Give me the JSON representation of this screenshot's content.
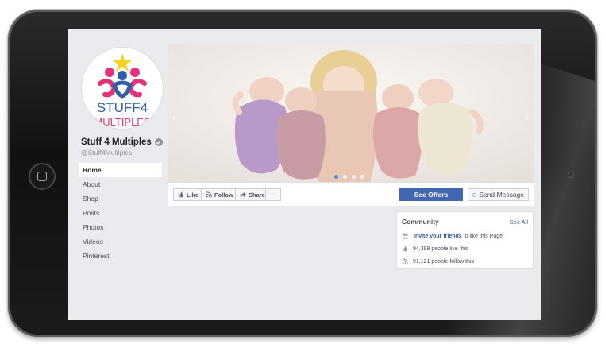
{
  "page": {
    "name": "Stuff 4 Multiples",
    "handle": "@Stuff4Multiples"
  },
  "nav": {
    "items": [
      "Home",
      "About",
      "Shop",
      "Posts",
      "Photos",
      "Videos",
      "Pinterest"
    ]
  },
  "actions": {
    "like": "Like",
    "follow": "Follow",
    "share": "Share",
    "more": "···",
    "see_offers": "See Offers",
    "send_message": "Send Message"
  },
  "community": {
    "title": "Community",
    "see_all": "See All",
    "invite_link": "Invite your friends",
    "invite_rest": " to like this Page",
    "likes": "94,399 people like this",
    "follows": "91,121 people follow this"
  },
  "logo": {
    "text_top": "STUFF4",
    "text_bottom": "MULTIPLES"
  },
  "cover": {
    "slide_count": 4,
    "active_slide": 1
  },
  "colors": {
    "facebook_blue": "#4267b2",
    "link_blue": "#365899",
    "background": "#e9ebee",
    "logo_pink": "#e4317c",
    "logo_blue": "#2e5ea8",
    "logo_star": "#f7d21e"
  },
  "icons": {
    "like": "thumbs-up-icon",
    "follow": "rss-icon",
    "share": "share-arrow-icon",
    "message": "messenger-icon",
    "verified": "verified-badge-icon",
    "invite": "people-icon",
    "likes": "thumbs-up-icon",
    "follows": "rss-icon"
  }
}
